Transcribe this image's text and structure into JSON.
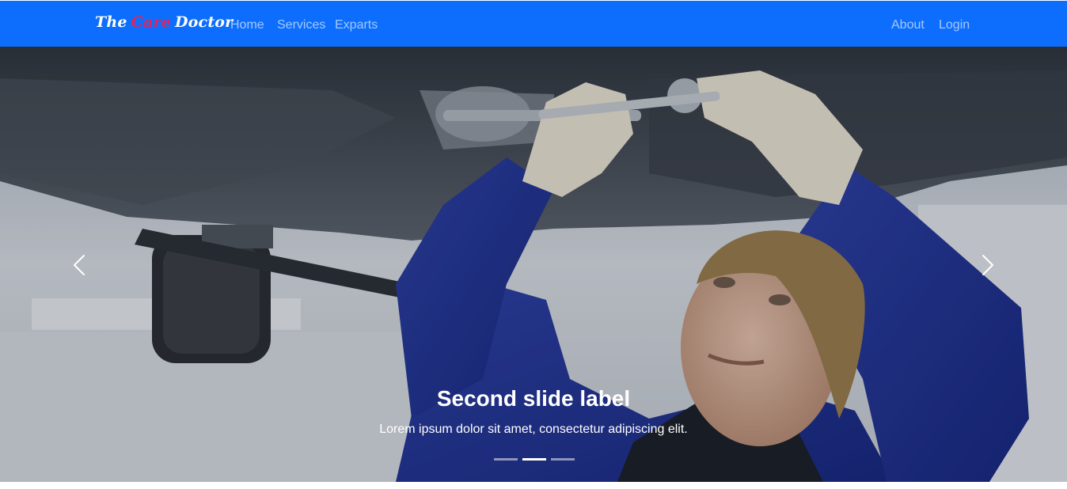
{
  "navbar": {
    "brand": {
      "part1": "The",
      "part2": "Care",
      "part3": "Doctor"
    },
    "links_left": [
      "Home",
      "Services",
      "Exparts"
    ],
    "links_right": [
      "About",
      "Login"
    ],
    "colors": {
      "background": "#0d6efd",
      "brand_accent": "#e0245e"
    }
  },
  "carousel": {
    "caption_title": "Second slide label",
    "caption_text": "Lorem ipsum dolor sit amet, consectetur adipiscing elit.",
    "indicator_count": 3,
    "active_index": 1,
    "prev_icon": "chevron-left-icon",
    "next_icon": "chevron-right-icon",
    "image": "mechanic-under-car"
  }
}
